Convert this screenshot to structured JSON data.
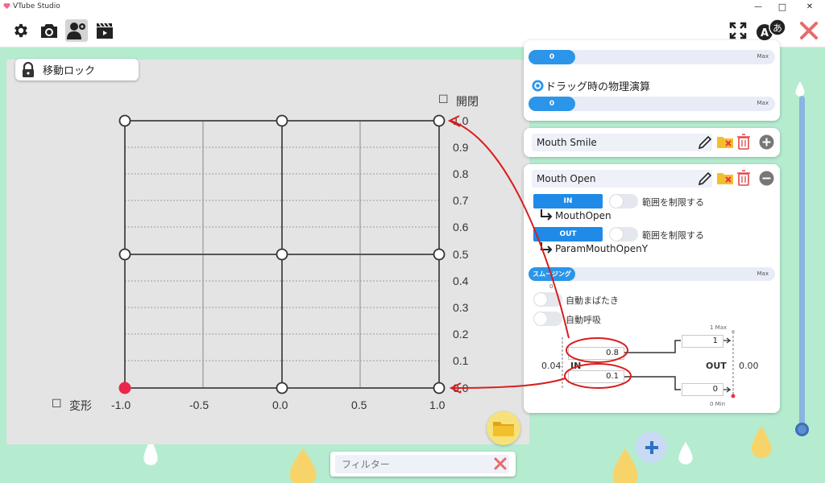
{
  "titlebar": {
    "title": "VTube Studio",
    "minimize": "—",
    "maximize": "□",
    "close": "✕"
  },
  "graph": {
    "lock_label": "移動ロック",
    "y_axis_label": "開閉",
    "x_axis_label": "変形",
    "y_ticks": [
      "1.0",
      "0.9",
      "0.8",
      "0.7",
      "0.6",
      "0.5",
      "0.4",
      "0.3",
      "0.2",
      "0.1",
      "0.0"
    ],
    "x_ticks": [
      "-1.0",
      "-0.5",
      "0.0",
      "0.5",
      "1.0"
    ],
    "active_point": "-1.0, 0.0"
  },
  "filter": {
    "placeholder": "フィルター"
  },
  "top_card": {
    "slider1_value": "0",
    "slider1_max": "Max",
    "physics_label": "ドラッグ時の物理演算",
    "slider2_value": "0",
    "slider2_max": "Max"
  },
  "mouth_smile": {
    "name": "Mouth Smile"
  },
  "mouth_open": {
    "name": "Mouth Open",
    "in_label": "IN",
    "in_limit_label": "範囲を制限する",
    "in_param": "MouthOpen",
    "out_label": "OUT",
    "out_limit_label": "範囲を制限する",
    "out_param": "ParamMouthOpenY",
    "smoothing_label": "スムージング",
    "smoothing_max": "Max",
    "smoothing_value": "0",
    "auto_blink_label": "自動まばたき",
    "auto_breath_label": "自動呼吸",
    "in_max_value": "0.8",
    "in_min_value": "0.1",
    "in_current": "0.04",
    "in_heading": "IN",
    "out_heading": "OUT",
    "out_current": "0.00",
    "out_max_value": "1",
    "out_min_value": "0",
    "out_max_hint": "1 Max",
    "out_min_hint": "0 Min"
  },
  "colors": {
    "accent": "#1f8ae8",
    "background": "#b5ecd0",
    "annotation": "#d81e1e",
    "active_point": "#e8274b"
  }
}
